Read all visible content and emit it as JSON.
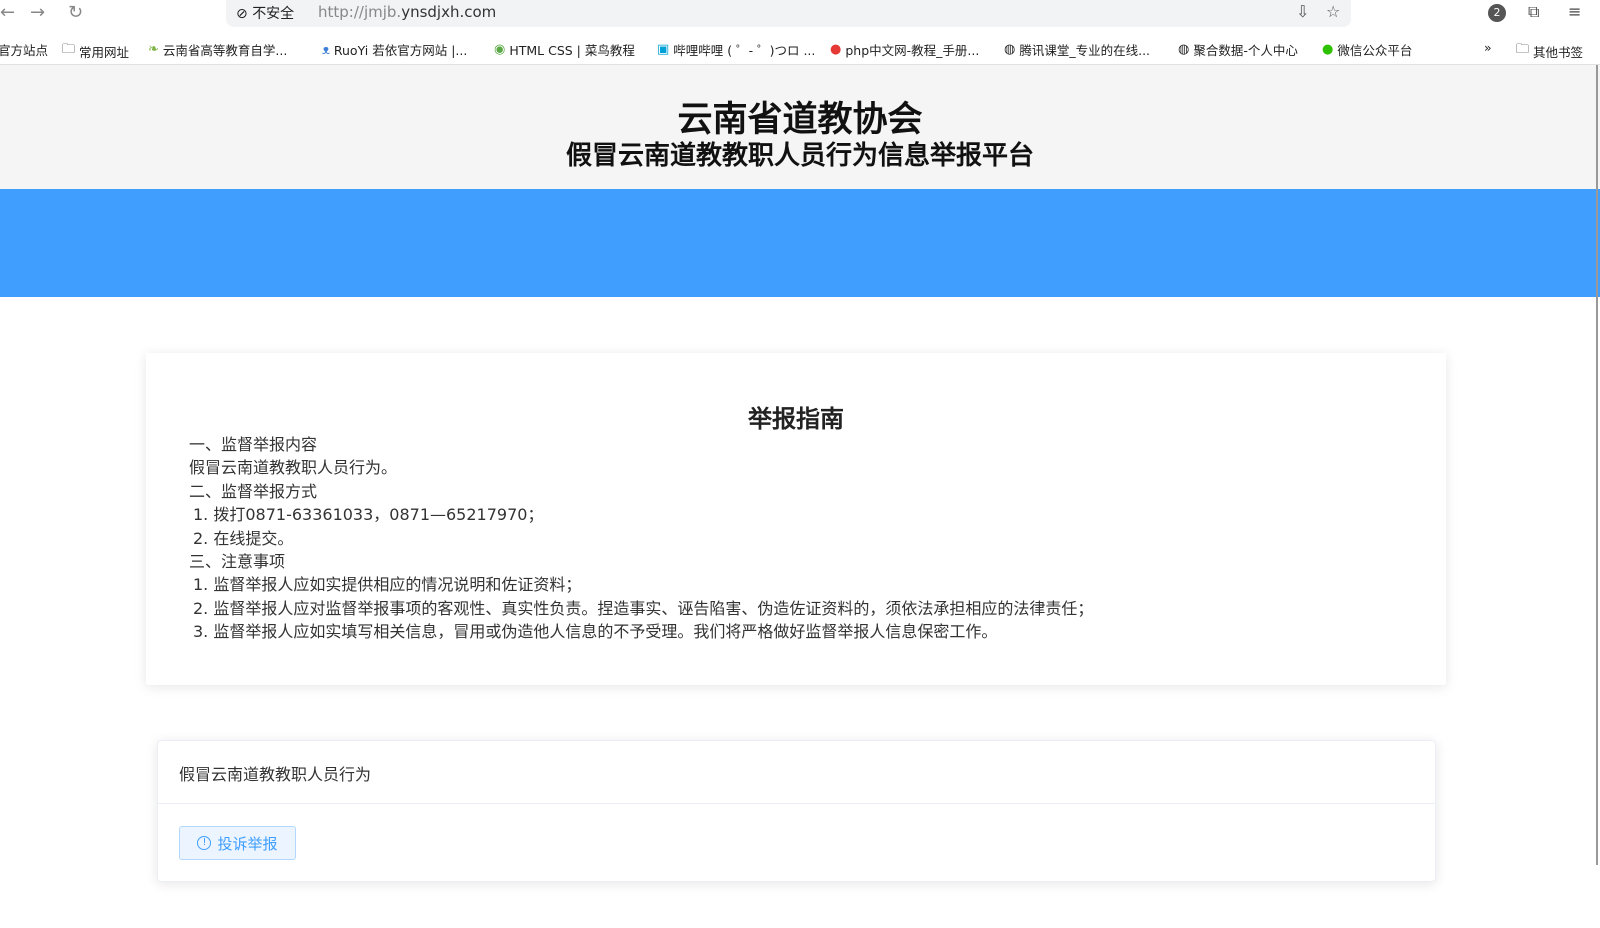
{
  "browser": {
    "security_label": "不安全",
    "url_prefix": "http://jmjb.",
    "url_domain": "ynsdjxh.com",
    "extension_badge": "2",
    "bookmarks": [
      {
        "label": "官方站点",
        "icon": "none"
      },
      {
        "label": "常用网址",
        "icon": "folder-icon"
      },
      {
        "label": "云南省高等教育自学...",
        "icon": "leaf-icon"
      },
      {
        "label": "RuoYi 若依官方网站 |...",
        "icon": "ruoyi-icon"
      },
      {
        "label": "HTML CSS | 菜鸟教程",
        "icon": "runoob-icon"
      },
      {
        "label": "哔哩哔哩 ( ゜- ゜)つロ ...",
        "icon": "bilibili-icon"
      },
      {
        "label": "php中文网-教程_手册...",
        "icon": "php-icon"
      },
      {
        "label": "腾讯课堂_专业的在线...",
        "icon": "globe-icon"
      },
      {
        "label": "聚合数据-个人中心",
        "icon": "globe-icon"
      },
      {
        "label": "微信公众平台",
        "icon": "wechat-icon"
      }
    ],
    "other_bookmarks": "其他书签"
  },
  "header": {
    "title": "云南省道教协会",
    "subtitle": "假冒云南道教教职人员行为信息举报平台"
  },
  "guide": {
    "title": "举报指南",
    "lines": [
      "一、监督举报内容",
      "假冒云南道教教职人员行为。",
      "二、监督举报方式",
      "1. 拨打0871-63361033，0871—65217970；",
      "2. 在线提交。",
      "三、注意事项",
      "1. 监督举报人应如实提供相应的情况说明和佐证资料；",
      "2. 监督举报人应对监督举报事项的客观性、真实性负责。捏造事实、诬告陷害、伪造佐证资料的，须依法承担相应的法律责任；",
      "3. 监督举报人应如实填写相关信息，冒用或伪造他人信息的不予受理。我们将严格做好监督举报人信息保密工作。"
    ]
  },
  "report_card": {
    "header": "假冒云南道教教职人员行为",
    "button_label": "投诉举报"
  },
  "colors": {
    "banner": "#409eff",
    "button_bg": "#ecf5ff",
    "button_text": "#409eff"
  }
}
